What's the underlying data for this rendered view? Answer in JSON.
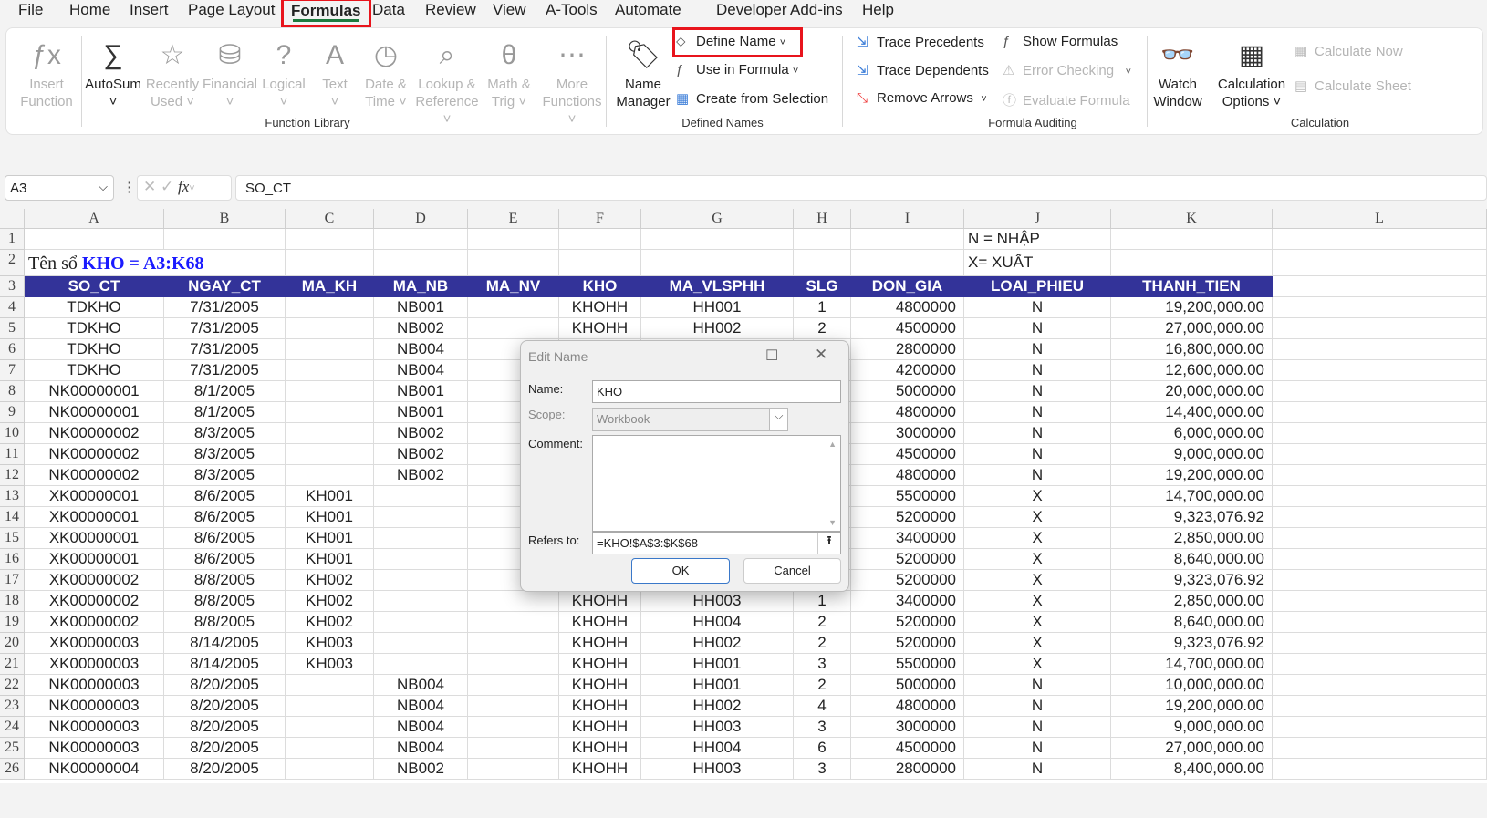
{
  "menu_tabs": [
    "File",
    "Home",
    "Insert",
    "Page Layout",
    "Formulas",
    "Data",
    "Review",
    "View",
    "A-Tools",
    "Automate",
    "Developer",
    "Add-ins",
    "Help"
  ],
  "active_tab": "Formulas",
  "ribbon": {
    "function_library": {
      "label": "Function Library",
      "items": [
        {
          "label1": "Insert",
          "label2": "Function",
          "icon": "fx-icon",
          "enabled": false
        },
        {
          "label1": "AutoSum",
          "label2": "˅",
          "icon": "sigma-icon",
          "enabled": true
        },
        {
          "label1": "Recently",
          "label2": "Used ˅",
          "icon": "star-book-icon",
          "enabled": false
        },
        {
          "label1": "Financial",
          "label2": "˅",
          "icon": "coins-book-icon",
          "enabled": false
        },
        {
          "label1": "Logical",
          "label2": "˅",
          "icon": "question-book-icon",
          "enabled": false
        },
        {
          "label1": "Text",
          "label2": "˅",
          "icon": "text-book-icon",
          "enabled": false
        },
        {
          "label1": "Date &",
          "label2": "Time ˅",
          "icon": "clock-book-icon",
          "enabled": false
        },
        {
          "label1": "Lookup &",
          "label2": "Reference ˅",
          "icon": "magnifier-book-icon",
          "enabled": false
        },
        {
          "label1": "Math &",
          "label2": "Trig ˅",
          "icon": "theta-book-icon",
          "enabled": false
        },
        {
          "label1": "More",
          "label2": "Functions ˅",
          "icon": "ellipsis-book-icon",
          "enabled": false
        }
      ]
    },
    "defined_names": {
      "label": "Defined Names",
      "name_manager1": "Name",
      "name_manager2": "Manager",
      "define_name": "Define Name",
      "use_in_formula": "Use in Formula",
      "create_from_selection": "Create from Selection"
    },
    "formula_auditing": {
      "label": "Formula Auditing",
      "trace_precedents": "Trace Precedents",
      "trace_dependents": "Trace Dependents",
      "remove_arrows": "Remove Arrows",
      "show_formulas": "Show Formulas",
      "error_checking": "Error Checking",
      "evaluate_formula": "Evaluate Formula",
      "watch1": "Watch",
      "watch2": "Window"
    },
    "calculation": {
      "label": "Calculation",
      "options1": "Calculation",
      "options2": "Options ˅",
      "calculate_now": "Calculate Now",
      "calculate_sheet": "Calculate Sheet"
    }
  },
  "formula_bar": {
    "name_box": "A3",
    "formula": "SO_CT"
  },
  "columns": [
    "A",
    "B",
    "C",
    "D",
    "E",
    "F",
    "G",
    "H",
    "I",
    "J",
    "K",
    "L"
  ],
  "row1": {
    "J": "N = NHẬP"
  },
  "row2": {
    "title_prefix": "Tên sổ ",
    "title_highlight": "KHO = A3:K68",
    "J": "X= XUẤT"
  },
  "header_row": [
    "SO_CT",
    "NGAY_CT",
    "MA_KH",
    "MA_NB",
    "MA_NV",
    "KHO",
    "MA_VLSPHH",
    "SLG",
    "DON_GIA",
    "LOAI_PHIEU",
    "THANH_TIEN"
  ],
  "header_color": "#333399",
  "title_color": "#1a1aff",
  "rows": [
    [
      "TDKHO",
      "7/31/2005",
      "",
      "NB001",
      "",
      "KHOHH",
      "HH001",
      "1",
      "4800000",
      "N",
      "19,200,000.00"
    ],
    [
      "TDKHO",
      "7/31/2005",
      "",
      "NB002",
      "",
      "KHOHH",
      "HH002",
      "2",
      "4500000",
      "N",
      "27,000,000.00"
    ],
    [
      "TDKHO",
      "7/31/2005",
      "",
      "NB004",
      "",
      "",
      "",
      "",
      "2800000",
      "N",
      "16,800,000.00"
    ],
    [
      "TDKHO",
      "7/31/2005",
      "",
      "NB004",
      "",
      "",
      "",
      "",
      "4200000",
      "N",
      "12,600,000.00"
    ],
    [
      "NK00000001",
      "8/1/2005",
      "",
      "NB001",
      "",
      "",
      "",
      "",
      "5000000",
      "N",
      "20,000,000.00"
    ],
    [
      "NK00000001",
      "8/1/2005",
      "",
      "NB001",
      "",
      "",
      "",
      "",
      "4800000",
      "N",
      "14,400,000.00"
    ],
    [
      "NK00000002",
      "8/3/2005",
      "",
      "NB002",
      "",
      "",
      "",
      "",
      "3000000",
      "N",
      "6,000,000.00"
    ],
    [
      "NK00000002",
      "8/3/2005",
      "",
      "NB002",
      "",
      "",
      "",
      "",
      "4500000",
      "N",
      "9,000,000.00"
    ],
    [
      "NK00000002",
      "8/3/2005",
      "",
      "NB002",
      "",
      "",
      "",
      "",
      "4800000",
      "N",
      "19,200,000.00"
    ],
    [
      "XK00000001",
      "8/6/2005",
      "KH001",
      "",
      "",
      "",
      "",
      "",
      "5500000",
      "X",
      "14,700,000.00"
    ],
    [
      "XK00000001",
      "8/6/2005",
      "KH001",
      "",
      "",
      "",
      "",
      "",
      "5200000",
      "X",
      "9,323,076.92"
    ],
    [
      "XK00000001",
      "8/6/2005",
      "KH001",
      "",
      "",
      "",
      "",
      "",
      "3400000",
      "X",
      "2,850,000.00"
    ],
    [
      "XK00000001",
      "8/6/2005",
      "KH001",
      "",
      "",
      "",
      "",
      "",
      "5200000",
      "X",
      "8,640,000.00"
    ],
    [
      "XK00000002",
      "8/8/2005",
      "KH002",
      "",
      "",
      "",
      "",
      "",
      "5200000",
      "X",
      "9,323,076.92"
    ],
    [
      "XK00000002",
      "8/8/2005",
      "KH002",
      "",
      "",
      "KHOHH",
      "HH003",
      "1",
      "3400000",
      "X",
      "2,850,000.00"
    ],
    [
      "XK00000002",
      "8/8/2005",
      "KH002",
      "",
      "",
      "KHOHH",
      "HH004",
      "2",
      "5200000",
      "X",
      "8,640,000.00"
    ],
    [
      "XK00000003",
      "8/14/2005",
      "KH003",
      "",
      "",
      "KHOHH",
      "HH002",
      "2",
      "5200000",
      "X",
      "9,323,076.92"
    ],
    [
      "XK00000003",
      "8/14/2005",
      "KH003",
      "",
      "",
      "KHOHH",
      "HH001",
      "3",
      "5500000",
      "X",
      "14,700,000.00"
    ],
    [
      "NK00000003",
      "8/20/2005",
      "",
      "NB004",
      "",
      "KHOHH",
      "HH001",
      "2",
      "5000000",
      "N",
      "10,000,000.00"
    ],
    [
      "NK00000003",
      "8/20/2005",
      "",
      "NB004",
      "",
      "KHOHH",
      "HH002",
      "4",
      "4800000",
      "N",
      "19,200,000.00"
    ],
    [
      "NK00000003",
      "8/20/2005",
      "",
      "NB004",
      "",
      "KHOHH",
      "HH003",
      "3",
      "3000000",
      "N",
      "9,000,000.00"
    ],
    [
      "NK00000003",
      "8/20/2005",
      "",
      "NB004",
      "",
      "KHOHH",
      "HH004",
      "6",
      "4500000",
      "N",
      "27,000,000.00"
    ],
    [
      "NK00000004",
      "8/20/2005",
      "",
      "NB002",
      "",
      "KHOHH",
      "HH003",
      "3",
      "2800000",
      "N",
      "8,400,000.00"
    ]
  ],
  "dialog": {
    "title": "Edit Name",
    "name_label": "Name:",
    "name_value": "KHO",
    "scope_label": "Scope:",
    "scope_value": "Workbook",
    "comment_label": "Comment:",
    "comment_value": "",
    "refers_label": "Refers to:",
    "refers_value": "=KHO!$A$3:$K$68",
    "ok": "OK",
    "cancel": "Cancel"
  }
}
